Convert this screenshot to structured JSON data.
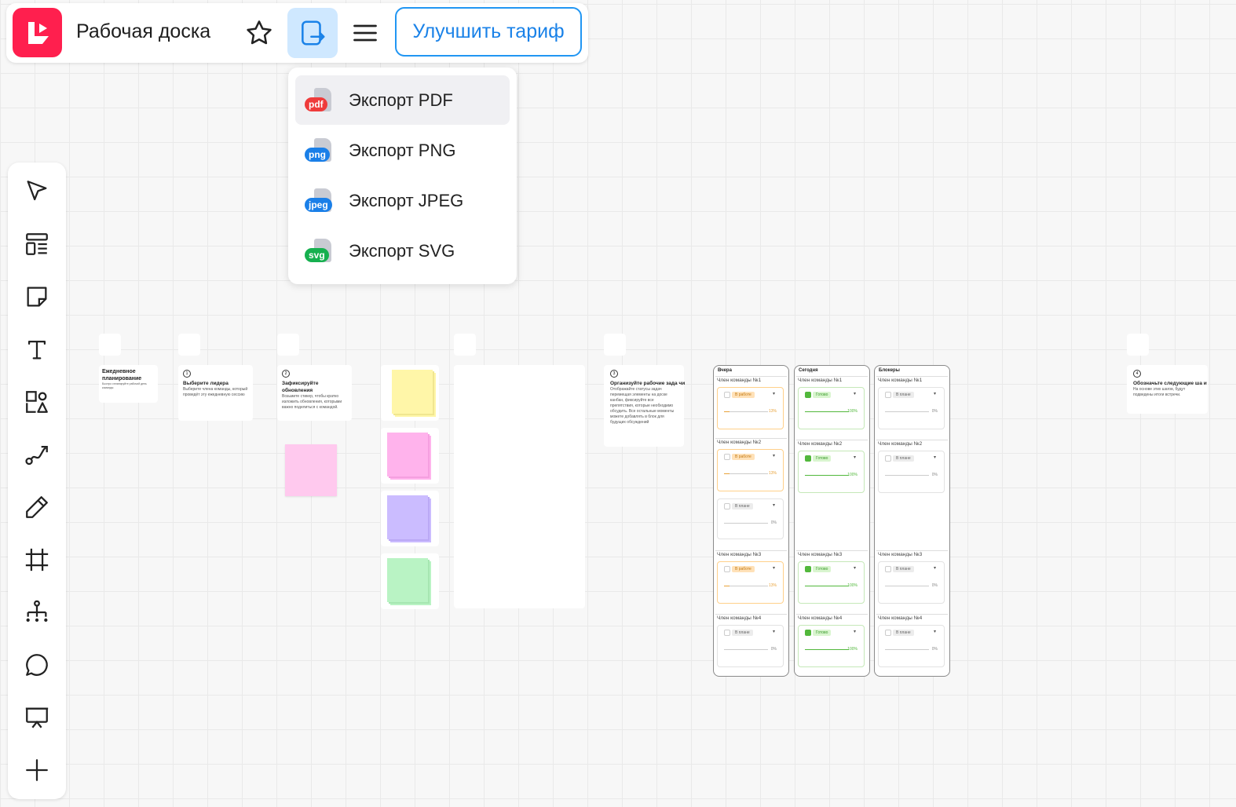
{
  "header": {
    "board_title": "Рабочая доска",
    "upgrade_label": "Улучшить тариф"
  },
  "export_menu": {
    "items": [
      {
        "label": "Экспорт PDF",
        "badge": "pdf",
        "color": "#ef3b3b"
      },
      {
        "label": "Экспорт PNG",
        "badge": "png",
        "color": "#1a7fe8"
      },
      {
        "label": "Экспорт JPEG",
        "badge": "jpeg",
        "color": "#1a7fe8"
      },
      {
        "label": "Экспорт SVG",
        "badge": "svg",
        "color": "#16b04f"
      }
    ]
  },
  "toolbar": {
    "tools": [
      "select-icon",
      "templates-icon",
      "sticky-note-icon",
      "text-icon",
      "shapes-icon",
      "connector-icon",
      "pen-icon",
      "frame-icon",
      "mindmap-icon",
      "comment-icon",
      "presentation-icon",
      "add-icon"
    ]
  },
  "board": {
    "title_card": {
      "title": "Ежедневное планирование",
      "desc": "Быстро спланируйте рабочий день команды"
    },
    "step1": {
      "num": "1",
      "title": "Выберите лидера",
      "desc": "Выберите члена команды, который проведёт эту ежедневную сессию"
    },
    "step2": {
      "num": "2",
      "title": "Зафиксируйте обновления",
      "desc": "Возьмите стикер, чтобы кратко изложить обновления, которыми важно поделиться с командой."
    },
    "step3": {
      "num": "3",
      "title": "Организуйте рабочие зада чи",
      "desc": "Отображайте статусы задач перемещая элементы на доске канбан, фиксируйте все препятствия, которые необходимо обсудить. Все остальные моменты можете добавлять в блок для будущих обсуждений"
    },
    "step4": {
      "num": "4",
      "title": "Обозначьте следующие ша и",
      "desc": "На основе этих шагов, будут подведены итоги встречи."
    },
    "columns": [
      {
        "title": "Вчера",
        "members": [
          {
            "name": "Член команды №1",
            "status": "В работе",
            "pct": "13%"
          },
          {
            "name": "Член команды №2",
            "status": "В работе",
            "pct": "13%"
          },
          {
            "name": "",
            "status": "В плане",
            "pct": "0%"
          },
          {
            "name": "Член команды №3",
            "status": "В работе",
            "pct": "13%"
          },
          {
            "name": "Член команды №4",
            "status": "В плане",
            "pct": "0%"
          }
        ]
      },
      {
        "title": "Сегодня",
        "members": [
          {
            "name": "Член команды №1",
            "status": "Готово",
            "pct": "100%"
          },
          {
            "name": "Член команды №2",
            "status": "Готово",
            "pct": "100%"
          },
          {
            "name": "Член команды №3",
            "status": "Готово",
            "pct": "100%"
          },
          {
            "name": "Член команды №4",
            "status": "Готово",
            "pct": "100%"
          }
        ]
      },
      {
        "title": "Блокеры",
        "members": [
          {
            "name": "Член команды №1",
            "status": "В плане",
            "pct": "0%"
          },
          {
            "name": "Член команды №2",
            "status": "В плане",
            "pct": "0%"
          },
          {
            "name": "Член команды №3",
            "status": "В плане",
            "pct": "0%"
          },
          {
            "name": "Член команды №4",
            "status": "В плане",
            "pct": "0%"
          }
        ]
      }
    ],
    "sticky_colors": [
      "#fff6a8",
      "#ffb3ec",
      "#cbbcff",
      "#b9f3c4"
    ]
  }
}
